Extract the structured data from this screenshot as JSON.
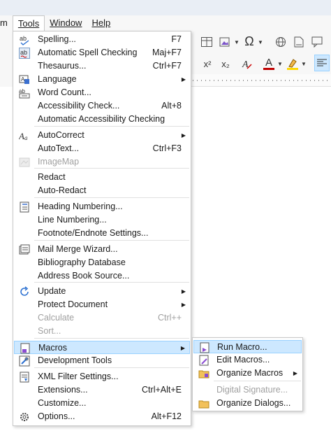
{
  "menubar": {
    "items": [
      {
        "label": "m",
        "accel": ""
      },
      {
        "label": "Tools",
        "accel": "T"
      },
      {
        "label": "Window",
        "accel": "W"
      },
      {
        "label": "Help",
        "accel": "H"
      }
    ]
  },
  "toolbar": {
    "row1_icons": [
      "table-icon",
      "image-icon",
      "chart-icon",
      "special-character-icon",
      "hyperlink-icon",
      "footnote-icon",
      "comment-icon"
    ],
    "row2_icons": [
      "superscript-icon",
      "subscript-icon",
      "clear-formatting-icon",
      "font-color-icon",
      "highlight-icon",
      "align-left-icon"
    ],
    "superscript": "x²",
    "subscript": "x₂",
    "font_color_glyph": "A",
    "special_char": "Ω"
  },
  "tools_menu": {
    "items": [
      {
        "label": "Spelling...",
        "shortcut": "F7",
        "icon": "spelling-icon"
      },
      {
        "label": "Automatic Spell Checking",
        "shortcut": "Maj+F7",
        "icon": "auto-spell-icon"
      },
      {
        "label": "Thesaurus...",
        "shortcut": "Ctrl+F7",
        "icon": ""
      },
      {
        "label": "Language",
        "shortcut": "",
        "icon": "language-icon",
        "submenu": true
      },
      {
        "label": "Word Count...",
        "shortcut": "",
        "icon": "word-count-icon"
      },
      {
        "label": "Accessibility Check...",
        "shortcut": "Alt+8",
        "icon": ""
      },
      {
        "label": "Automatic Accessibility Checking",
        "shortcut": "",
        "icon": ""
      },
      {
        "label": "AutoCorrect",
        "shortcut": "",
        "icon": "autocorrect-icon",
        "submenu": true
      },
      {
        "label": "AutoText...",
        "shortcut": "Ctrl+F3",
        "icon": ""
      },
      {
        "label": "ImageMap",
        "shortcut": "",
        "icon": "imagemap-icon",
        "disabled": true
      },
      {
        "label": "Redact",
        "shortcut": "",
        "icon": ""
      },
      {
        "label": "Auto-Redact",
        "shortcut": "",
        "icon": ""
      },
      {
        "label": "Heading Numbering...",
        "shortcut": "",
        "icon": "heading-numbering-icon"
      },
      {
        "label": "Line Numbering...",
        "shortcut": "",
        "icon": ""
      },
      {
        "label": "Footnote/Endnote Settings...",
        "shortcut": "",
        "icon": ""
      },
      {
        "label": "Mail Merge Wizard...",
        "shortcut": "",
        "icon": "mail-merge-icon"
      },
      {
        "label": "Bibliography Database",
        "shortcut": "",
        "icon": ""
      },
      {
        "label": "Address Book Source...",
        "shortcut": "",
        "icon": ""
      },
      {
        "label": "Update",
        "shortcut": "",
        "icon": "update-icon",
        "submenu": true
      },
      {
        "label": "Protect Document",
        "shortcut": "",
        "icon": "",
        "submenu": true
      },
      {
        "label": "Calculate",
        "shortcut": "Ctrl++",
        "icon": "",
        "disabled": true
      },
      {
        "label": "Sort...",
        "shortcut": "",
        "icon": "",
        "disabled": true
      },
      {
        "label": "Macros",
        "shortcut": "",
        "icon": "macros-icon",
        "submenu": true,
        "highlighted": true
      },
      {
        "label": "Development Tools",
        "shortcut": "",
        "icon": "development-tools-icon"
      },
      {
        "label": "XML Filter Settings...",
        "shortcut": "",
        "icon": "xml-filter-icon"
      },
      {
        "label": "Extensions...",
        "shortcut": "Ctrl+Alt+E",
        "icon": ""
      },
      {
        "label": "Customize...",
        "shortcut": "",
        "icon": ""
      },
      {
        "label": "Options...",
        "shortcut": "Alt+F12",
        "icon": "options-gear-icon"
      }
    ]
  },
  "macros_submenu": {
    "items": [
      {
        "label": "Run Macro...",
        "icon": "run-macro-icon",
        "highlighted": true
      },
      {
        "label": "Edit Macros...",
        "icon": "edit-macros-icon"
      },
      {
        "label": "Organize Macros",
        "icon": "organize-macros-icon",
        "submenu": true
      },
      {
        "label": "Digital Signature...",
        "icon": "",
        "disabled": true
      },
      {
        "label": "Organize Dialogs...",
        "icon": "organize-dialogs-icon"
      }
    ]
  },
  "colors": {
    "highlight_bg": "#cde8ff",
    "highlight_border": "#99d1ff",
    "disabled_text": "#a0a0a0",
    "font_color_underline": "#c00000",
    "highlight_color_underline": "#ffd800"
  }
}
